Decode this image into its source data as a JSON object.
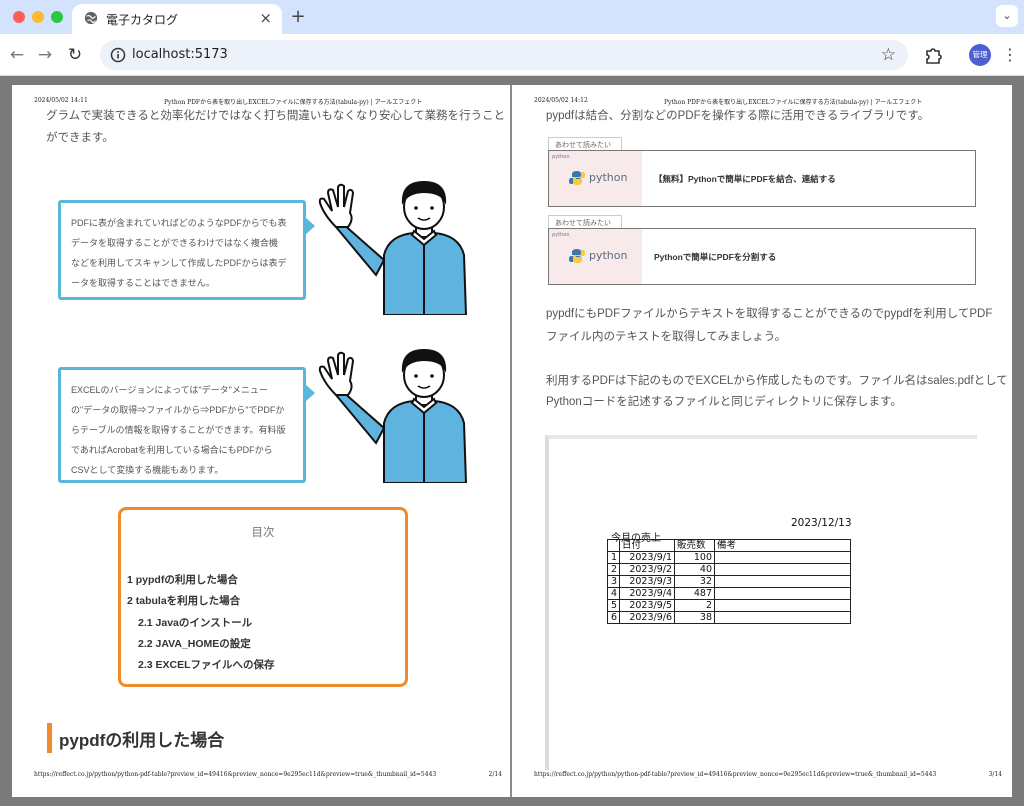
{
  "browser": {
    "tab_title": "電子カタログ",
    "url": "localhost:5173",
    "profile_label": "管理"
  },
  "left_page": {
    "header_date": "2024/05/02 14:11",
    "header_title": "Python PDFから表を取り出しEXCELファイルに保存する方法(tabula-py) | アールエフェクト",
    "intro_line1": "グラムで実装できると効率化だけではなく打ち間違いもなくなり安心して業務を行うこと",
    "intro_line2": "ができます。",
    "bubble1": [
      "PDFに表が含まれていればどのようなPDFからでも表",
      "データを取得することができるわけではなく複合機",
      "などを利用してスキャンして作成したPDFからは表デ",
      "ータを取得することはできません。"
    ],
    "bubble2": [
      "EXCELのバージョンによっては\"データ\"メニュー",
      "の\"データの取得⇒ファイルから⇒PDFから\"でPDFか",
      "らテーブルの情報を取得することができます。有料版",
      "であればAcrobatを利用している場合にもPDFから",
      "CSVとして変換する機能もあります。"
    ],
    "toc": {
      "title": "目次",
      "items": [
        "1 pypdfの利用した場合",
        "2 tabulaを利用した場合",
        "2.1 Javaのインストール",
        "2.2 JAVA_HOMEの設定",
        "2.3 EXCELファイルへの保存"
      ]
    },
    "section_title": "pypdfの利用した場合",
    "footer_url": "https://reffect.co.jp/python/python-pdf-table?preview_id=49416&preview_nonce=9e295ec11d&preview=true&_thumbnail_id=5443",
    "page_number": "2/14"
  },
  "right_page": {
    "header_date": "2024/05/02 14:12",
    "header_title": "Python PDFから表を取り出しEXCELファイルに保存する方法(tabula-py) | アールエフェクト",
    "intro": "pypdfは結合、分割などのPDFを操作する際に活用できるライブラリです。",
    "related": [
      {
        "tag": "あわせて読みたい",
        "thumb_label": "python",
        "logo_text": "python",
        "title": "【無料】Pythonで簡単にPDFを結合、連結する"
      },
      {
        "tag": "あわせて読みたい",
        "thumb_label": "python",
        "logo_text": "python",
        "title": "Pythonで簡単にPDFを分割する"
      }
    ],
    "para1_line1": "pypdfにもPDFファイルからテキストを取得することができるのでpypdfを利用してPDF",
    "para1_line2": "ファイル内のテキストを取得してみましょう。",
    "para2_line1": "利用するPDFは下記のものでEXCELから作成したものです。ファイル名はsales.pdfとして",
    "para2_line2": "Pythonコードを記述するファイルと同じディレクトリに保存します。",
    "sheet": {
      "date": "2023/12/13",
      "caption": "今月の売上",
      "headers": [
        "",
        "日付",
        "販売数",
        "備考"
      ],
      "rows": [
        [
          "1",
          "2023/9/1",
          "100",
          ""
        ],
        [
          "2",
          "2023/9/2",
          "40",
          ""
        ],
        [
          "3",
          "2023/9/3",
          "32",
          ""
        ],
        [
          "4",
          "2023/9/4",
          "487",
          ""
        ],
        [
          "5",
          "2023/9/5",
          "2",
          ""
        ],
        [
          "6",
          "2023/9/6",
          "38",
          ""
        ]
      ]
    },
    "footer_url": "https://reffect.co.jp/python/python-pdf-table?preview_id=49416&preview_nonce=9e295ec11d&preview=true&_thumbnail_id=5443",
    "page_number": "3/14"
  }
}
